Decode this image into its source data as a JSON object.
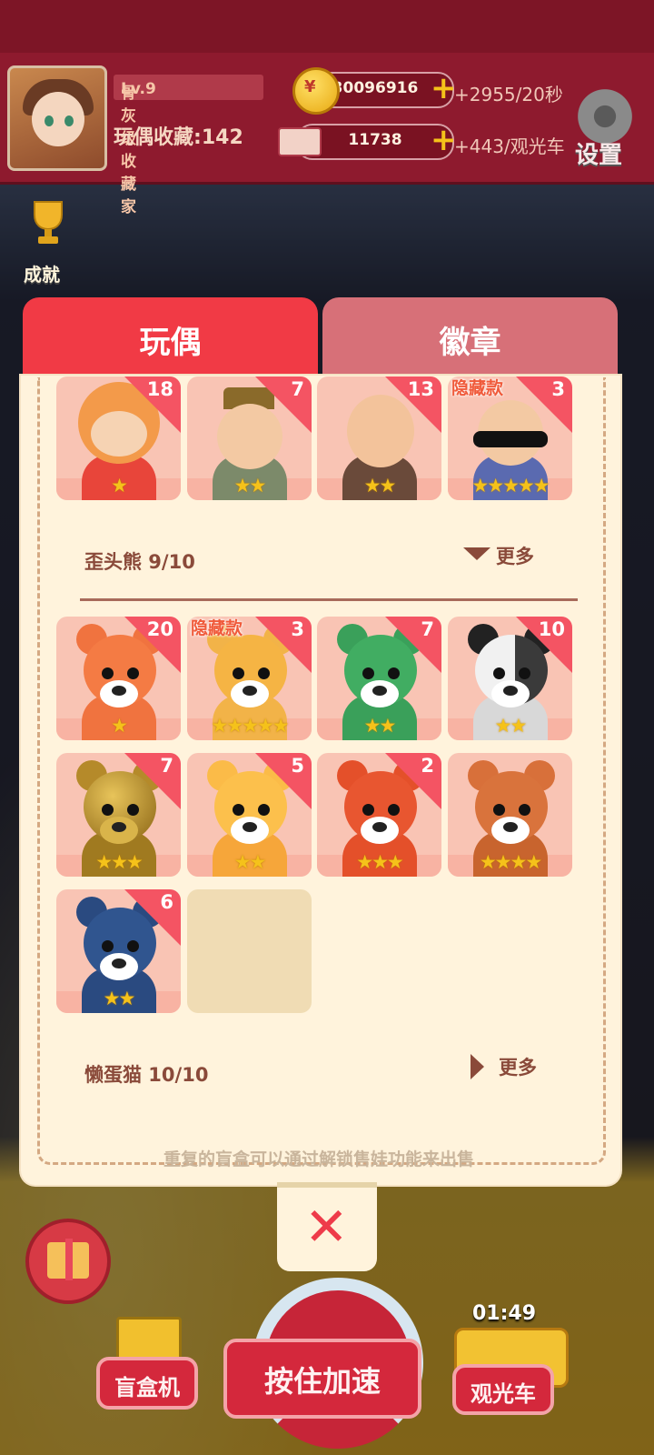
{
  "header": {
    "player_title": "骨灰级收藏家",
    "level": "Lv.9",
    "collection_label": "玩偶收藏",
    "collection_sep": ":",
    "collection_count": "142",
    "coins": "30096916",
    "coin_rate": "+2955/20秒",
    "tickets": "11738",
    "ticket_rate": "+443/观光车",
    "settings_label": "设置",
    "achievements_label": "成就"
  },
  "tabs": [
    {
      "label": "玩偶",
      "active": true
    },
    {
      "label": "徽章",
      "active": false
    }
  ],
  "top_row": [
    {
      "count": "18",
      "stars": 1,
      "hidden": false
    },
    {
      "count": "7",
      "stars": 2,
      "hidden": false
    },
    {
      "count": "13",
      "stars": 2,
      "hidden": false
    },
    {
      "count": "3",
      "stars": 5,
      "hidden": true
    }
  ],
  "series_1": {
    "name": "歪头熊 9/10",
    "more_label": "更多",
    "cards": [
      {
        "count": "20",
        "stars": 1,
        "hidden": false
      },
      {
        "count": "3",
        "stars": 5,
        "hidden": true
      },
      {
        "count": "7",
        "stars": 2,
        "hidden": false
      },
      {
        "count": "10",
        "stars": 2,
        "hidden": false
      },
      {
        "count": "7",
        "stars": 3,
        "hidden": false
      },
      {
        "count": "5",
        "stars": 2,
        "hidden": false
      },
      {
        "count": "2",
        "stars": 3,
        "hidden": false
      },
      {
        "count": "",
        "stars": 4,
        "hidden": false
      },
      {
        "count": "6",
        "stars": 2,
        "hidden": false
      }
    ]
  },
  "series_2": {
    "name": "懒蛋猫 10/10",
    "more_label": "更多"
  },
  "hidden_tag": "隐藏款",
  "hint": "重复的盲盒可以通过解锁售娃功能来出售",
  "close_label": "✕",
  "bottom": {
    "vending_label": "盲盒机",
    "hold_label": "按住加速",
    "tram_label": "观光车",
    "timer": "01:49"
  },
  "colors": {
    "active_tab": "#f13a45",
    "inactive_tab": "#d77078",
    "panel_bg": "#fff3dc",
    "card_bg": "#f9c4b4",
    "count_corner": "#f45463",
    "star": "#f5c21a"
  }
}
